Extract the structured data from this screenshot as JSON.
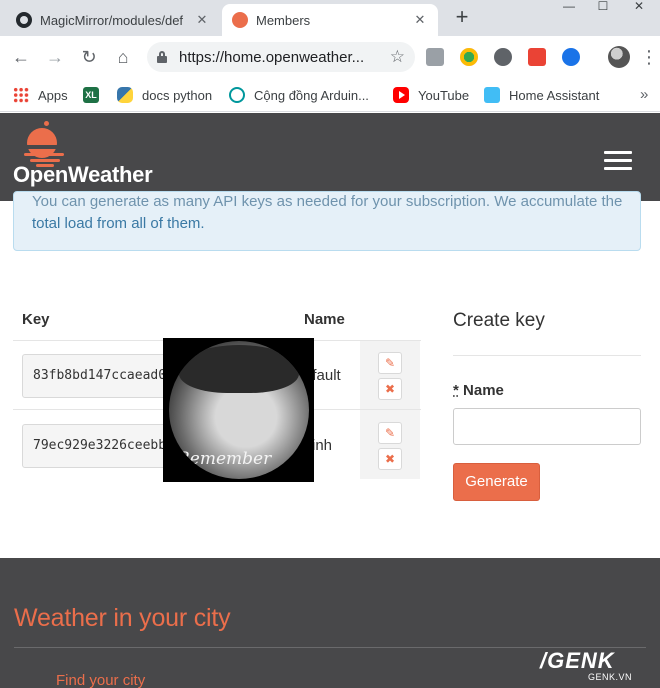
{
  "browser": {
    "tabs": [
      {
        "title": "MagicMirror/modules/def",
        "icon": "github-icon",
        "active": false
      },
      {
        "title": "Members",
        "icon": "openweather-favicon",
        "active": true
      }
    ],
    "new_tab": "+",
    "window_controls": {
      "minimize": "—",
      "maximize": "☐",
      "close": "✕"
    },
    "url": "https://home.openweather...",
    "nav": {
      "back": "←",
      "forward": "→",
      "reload": "↻",
      "home": "⌂",
      "star": "☆",
      "menu": "⋮"
    },
    "bookmarks": [
      {
        "label": "Apps",
        "icon": "apps-grid-icon"
      },
      {
        "label": "",
        "icon": "excel-icon"
      },
      {
        "label": "docs python",
        "icon": "python-icon"
      },
      {
        "label": "Cộng đồng Arduin...",
        "icon": "arduino-icon"
      },
      {
        "label": "YouTube",
        "icon": "youtube-icon"
      },
      {
        "label": "Home Assistant",
        "icon": "home-assistant-icon"
      }
    ],
    "bookmarks_more": "»",
    "xl_badge": "XL"
  },
  "page": {
    "logo_text": "OpenWeather",
    "alert": {
      "line1": "You can generate as many API keys as needed for your subscription. We accumulate the",
      "line2": "total load from all of them."
    },
    "table": {
      "headers": {
        "key": "Key",
        "name": "Name"
      },
      "rows": [
        {
          "key": "83fb8bd147ccaead0",
          "name": "efault"
        },
        {
          "key": "79ec929e3226ceebb",
          "name": "inh"
        }
      ],
      "edit_symbol": "✎",
      "delete_symbol": "✖"
    },
    "overlay_caption": "Remember",
    "create_key": {
      "title": "Create key",
      "star": "*",
      "name_label": "Name",
      "name_value": "",
      "button": "Generate"
    },
    "footer": {
      "title": "Weather in your city",
      "link": "Find your city"
    },
    "watermark": {
      "brand": "/GENK",
      "domain": "GENK.VN"
    }
  },
  "colors": {
    "accent": "#eb6e4b",
    "header_bg": "#48484a",
    "alert_bg": "#e5f0f8",
    "alert_text": "#3a79a4"
  }
}
